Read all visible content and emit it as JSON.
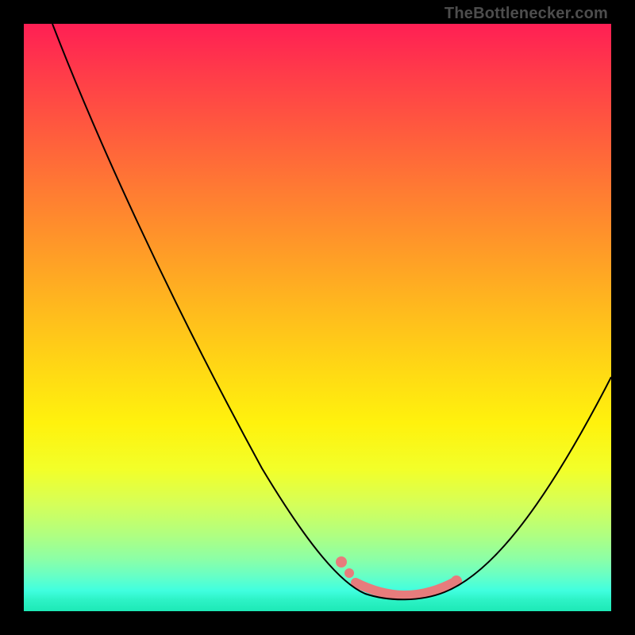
{
  "watermark": "TheBottlenecker.com",
  "chart_data": {
    "type": "line",
    "title": "",
    "xlabel": "",
    "ylabel": "",
    "xlim": [
      0,
      100
    ],
    "ylim": [
      0,
      100
    ],
    "grid": false,
    "legend": false,
    "background_gradient": {
      "orientation": "vertical",
      "stops": [
        {
          "pos": 0,
          "color": "#ff1f54"
        },
        {
          "pos": 50,
          "color": "#ffd615"
        },
        {
          "pos": 75,
          "color": "#f2ff2a"
        },
        {
          "pos": 100,
          "color": "#1de9b6"
        }
      ]
    },
    "series": [
      {
        "name": "bottleneck-curve",
        "x": [
          5,
          10,
          15,
          20,
          25,
          30,
          35,
          40,
          45,
          50,
          55,
          58,
          62,
          66,
          70,
          74,
          78,
          82,
          86,
          90,
          94,
          100
        ],
        "y": [
          100,
          92,
          83,
          74,
          65,
          56,
          47,
          38,
          29,
          20,
          11,
          6,
          3,
          2,
          2,
          3,
          6,
          12,
          20,
          30,
          40,
          55
        ],
        "color": "#000000"
      }
    ],
    "highlight_segment": {
      "name": "optimal-range",
      "color": "#e77c7c",
      "x": [
        55,
        58,
        62,
        66,
        70,
        74
      ],
      "y": [
        11,
        6,
        3,
        2,
        2,
        3
      ],
      "endpoint_dots": [
        {
          "x": 55,
          "y": 11
        },
        {
          "x": 74,
          "y": 3
        }
      ]
    }
  }
}
